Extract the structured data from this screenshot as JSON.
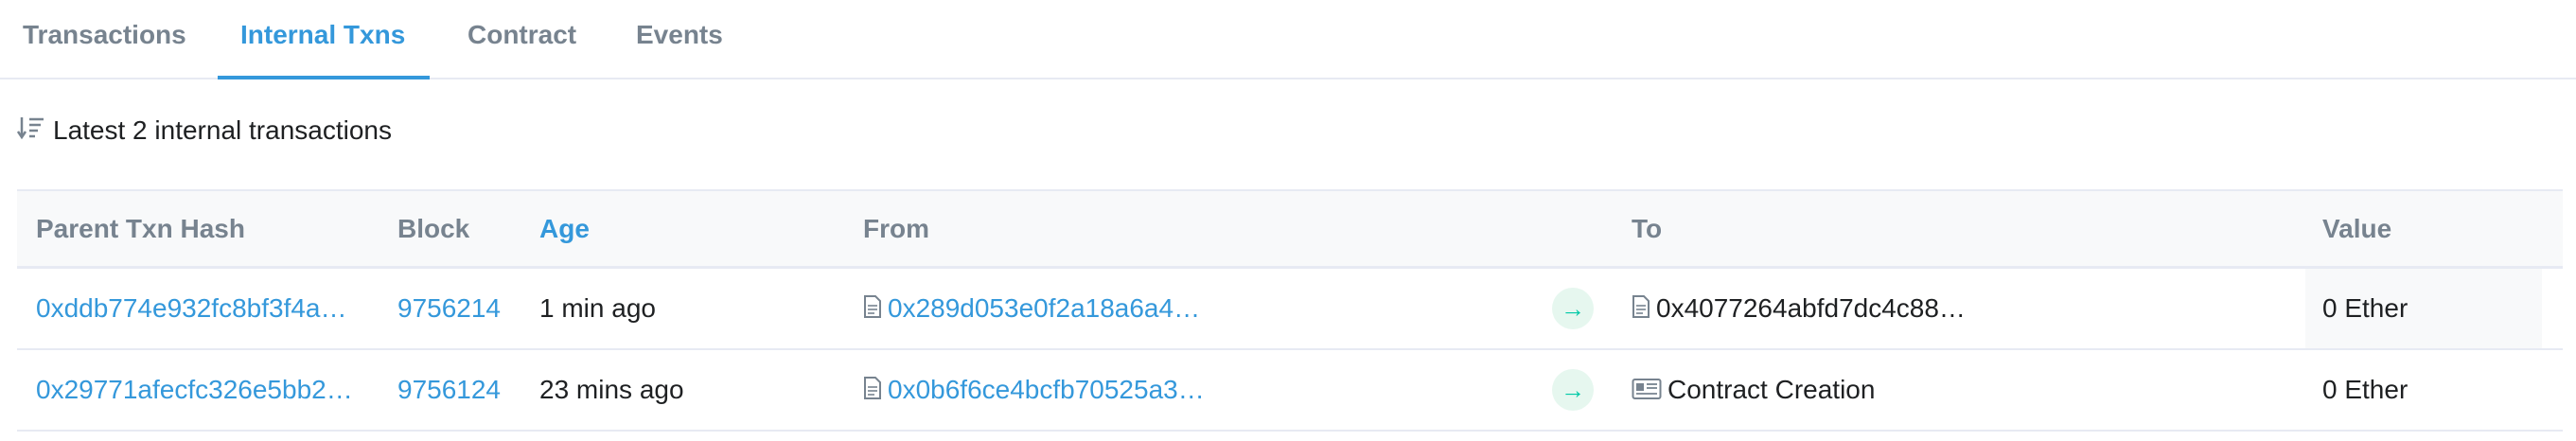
{
  "tabs": [
    {
      "label": "Transactions",
      "active": false
    },
    {
      "label": "Internal Txns",
      "active": true
    },
    {
      "label": "Contract",
      "active": false
    },
    {
      "label": "Events",
      "active": false
    }
  ],
  "summary": {
    "icon": "sort-desc-icon",
    "text": "Latest 2 internal transactions"
  },
  "table": {
    "headers": {
      "parent_txn_hash": "Parent Txn Hash",
      "block": "Block",
      "age": "Age",
      "from": "From",
      "to": "To",
      "value": "Value"
    },
    "rows": [
      {
        "parent_txn_hash": "0xddb774e932fc8bf3f4a…",
        "block": "9756214",
        "age": "1 min ago",
        "from": "0x289d053e0f2a18a6a4…",
        "to": "0x4077264abfd7dc4c88…",
        "to_icon": "contract-file-icon",
        "value": "0 Ether"
      },
      {
        "parent_txn_hash": "0x29771afecfc326e5bb2…",
        "block": "9756124",
        "age": "23 mins ago",
        "from": "0x0b6f6ce4bcfb70525a3…",
        "to": "Contract Creation",
        "to_icon": "contract-creation-icon",
        "value": "0 Ether"
      }
    ]
  },
  "colors": {
    "link": "#3498db",
    "muted": "#77838f",
    "success": "#00c9a7",
    "border": "#e7eaf3"
  }
}
